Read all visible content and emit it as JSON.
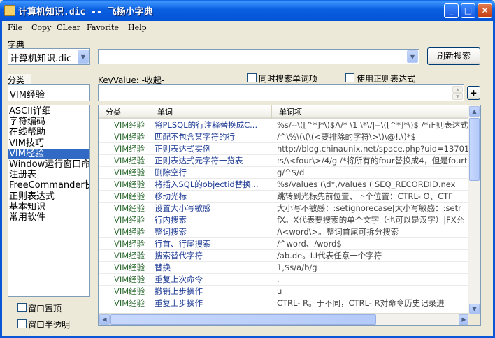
{
  "window": {
    "title": "计算机知识.dic  --  飞扬小字典"
  },
  "menu": [
    {
      "mnemonic": "F",
      "rest": "ile"
    },
    {
      "mnemonic": "C",
      "rest": "opy"
    },
    {
      "mnemonic": "C",
      "rest": "Lear"
    },
    {
      "mnemonic": "F",
      "rest": "avorite"
    },
    {
      "mnemonic": "H",
      "rest": "elp"
    }
  ],
  "dict": {
    "label": "字典",
    "selected": "计算机知识.dic"
  },
  "search": {
    "value": ""
  },
  "refresh_button": "刷新搜索",
  "category": {
    "label": "分类",
    "value": "VIM经验"
  },
  "keyvalue": {
    "label": "KeyValue: -收起-",
    "value": ""
  },
  "options": {
    "search_items": "同时搜索单词项",
    "use_regex": "使用正则表达式",
    "plus": "+"
  },
  "sidebar": {
    "items": [
      "ASCII详细",
      "字符编码",
      "在线帮助",
      "VIM技巧",
      "VIM经验",
      "Window运行窗口命令",
      "注册表",
      "FreeCommander快捷键",
      "正则表达式",
      "基本知识",
      "常用软件"
    ],
    "selected_index": 4
  },
  "window_options": {
    "topmost": "窗口置顶",
    "translucent": "窗口半透明"
  },
  "table": {
    "headers": [
      "分类",
      "单词",
      "单词项"
    ],
    "rows": [
      [
        "VIM经验",
        "将PLSQL的行注释替换成C...",
        "%s/--\\([^*]*\\)$/\\/* \\1 \\*\\/|--\\([^*]*\\)$   /*正则表达式"
      ],
      [
        "VIM经验",
        "匹配不包含某字符的行",
        "/^\\%\\(\\(\\(<要排除的字符\\>\\)\\@!.\\)*$"
      ],
      [
        "VIM经验",
        "正则表达式实例",
        "http://blog.chinaunix.net/space.php?uid=13701"
      ],
      [
        "VIM经验",
        "正则表达式元字符一览表",
        ":s/\\<four\\>/4/g /*将所有的four替换成4，但是fourte"
      ],
      [
        "VIM经验",
        "删除空行",
        "g/^$/d"
      ],
      [
        "VIM经验",
        "将插入SQL的objectid替换...",
        "%s/values (\\d*,/values ( SEQ_RECORDID.nex"
      ],
      [
        "VIM经验",
        "移动光标",
        "跳转到光标先前位置、下个位置：CTRL- O、CTF"
      ],
      [
        "VIM经验",
        "设置大小写敏感",
        "大小写不敏感：:setignorecase|大小写敏感：:setr"
      ],
      [
        "VIM经验",
        "行内搜索",
        "fX。X代表要搜索的单个文字（也可以是汉字）|FX允"
      ],
      [
        "VIM经验",
        "整词搜索",
        "/\\<word\\>。整词首尾可拆分搜索"
      ],
      [
        "VIM经验",
        "行首、行尾搜索",
        "/^word、/word$"
      ],
      [
        "VIM经验",
        "搜索替代字符",
        "/ab.de。I.I代表任意一个字符"
      ],
      [
        "VIM经验",
        "替换",
        "1,$s/a/b/g"
      ],
      [
        "VIM经验",
        "重复上次命令",
        "."
      ],
      [
        "VIM经验",
        "撤销上步操作",
        "u"
      ],
      [
        "VIM经验",
        "重复上步操作",
        "CTRL- R。于不同，CTRL- R对命令历史记录进"
      ]
    ]
  }
}
